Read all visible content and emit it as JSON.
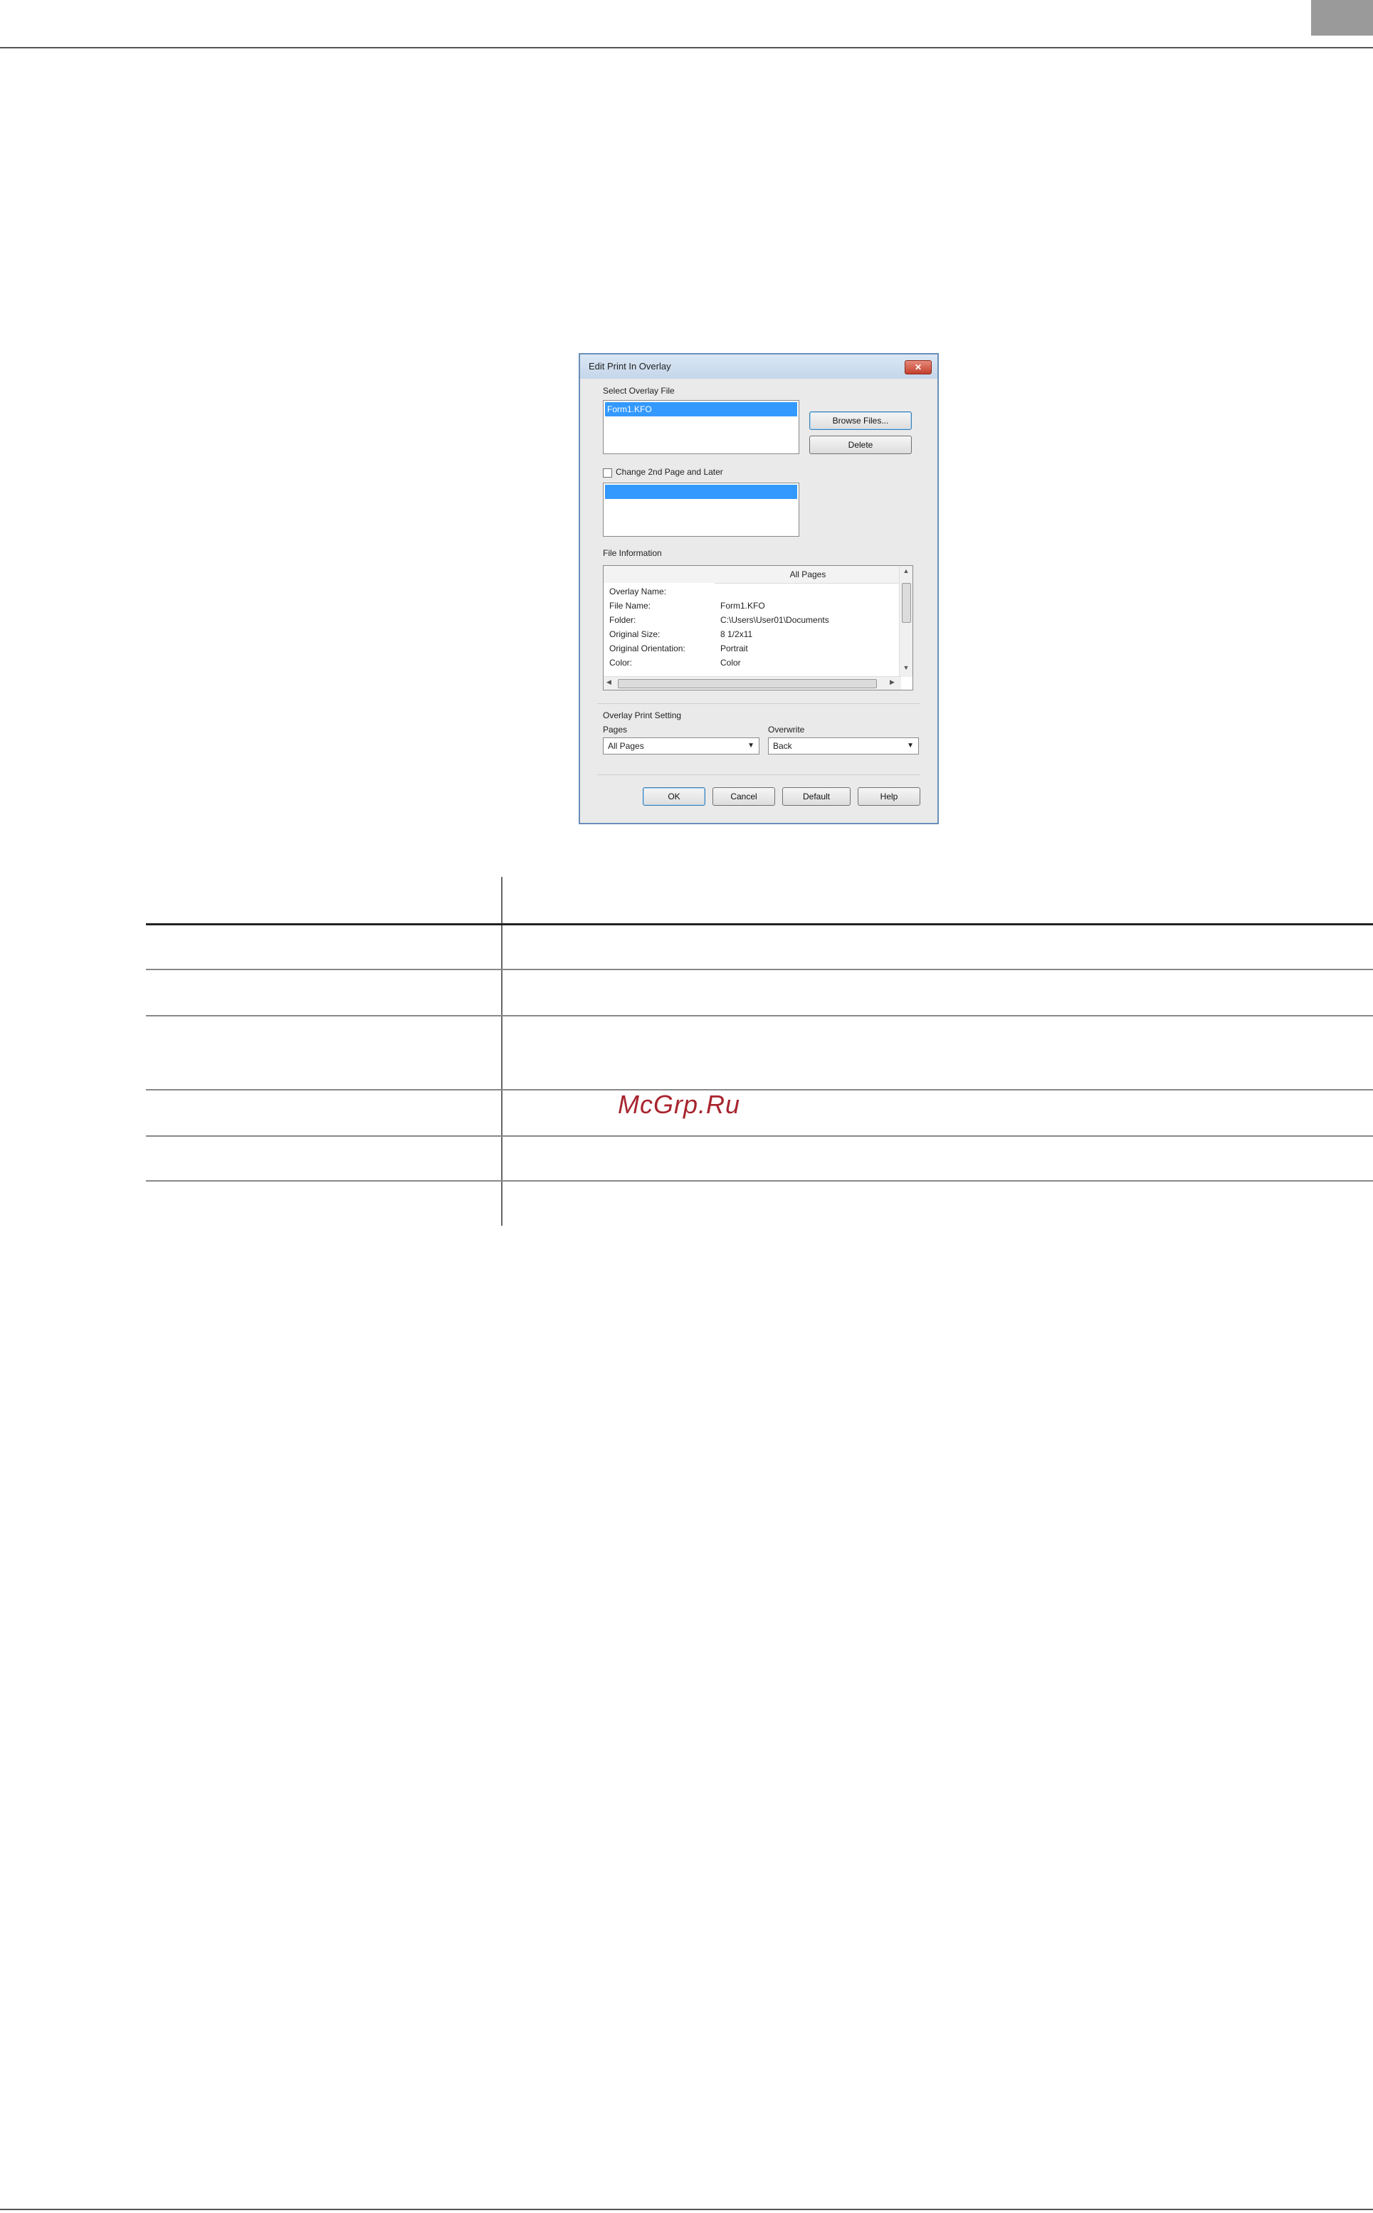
{
  "page": {
    "watermark": "McGrp.Ru"
  },
  "dialog": {
    "title": "Edit Print In Overlay",
    "close_label": "✕",
    "select_overlay_file_label": "Select Overlay File",
    "overlay_files": [
      "Form1.KFO"
    ],
    "browse_files_label": "Browse Files...",
    "delete_label": "Delete",
    "change_2nd_page_label": "Change 2nd Page and Later",
    "file_information_label": "File Information",
    "info_header": "All Pages",
    "info_rows": [
      {
        "key": "Overlay Name:",
        "value": ""
      },
      {
        "key": "File Name:",
        "value": "Form1.KFO"
      },
      {
        "key": "Folder:",
        "value": "C:\\Users\\User01\\Documents"
      },
      {
        "key": "Original Size:",
        "value": "8 1/2x11"
      },
      {
        "key": "Original Orientation:",
        "value": "Portrait"
      },
      {
        "key": "Color:",
        "value": "Color"
      }
    ],
    "overlay_print_setting_label": "Overlay Print Setting",
    "pages_label": "Pages",
    "pages_value": "All Pages",
    "overwrite_label": "Overwrite",
    "overwrite_value": "Back",
    "ok_label": "OK",
    "cancel_label": "Cancel",
    "default_label": "Default",
    "help_label": "Help"
  }
}
